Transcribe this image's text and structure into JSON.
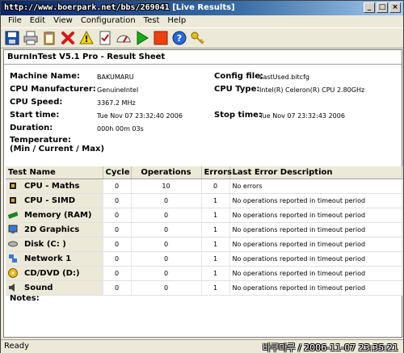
{
  "window": {
    "title_overlay": "http://www.boerpark.net/bbs/269041",
    "title_suffix": "[Live Results]",
    "btn_min": "_",
    "btn_max": "□",
    "btn_close": "×"
  },
  "menu": [
    "File",
    "Edit",
    "View",
    "Configuration",
    "Test",
    "Help"
  ],
  "toolbar": [
    "save-icon",
    "print-icon",
    "clipboard-icon",
    "stop-x-icon",
    "warning-icon",
    "checklist-icon",
    "speedometer-icon",
    "play-icon",
    "stop-icon",
    "help-icon",
    "key-icon"
  ],
  "sheet": {
    "title": "BurnInTest V5.1 Pro - Result Sheet",
    "machine_name_label": "Machine Name:",
    "machine_name": "BAKUMARU",
    "cpu_manufacturer_label": "CPU Manufacturer:",
    "cpu_manufacturer": "GenuineIntel",
    "cpu_speed_label": "CPU Speed:",
    "cpu_speed": "3367.2 MHz",
    "start_time_label": "Start time:",
    "start_time": "Tue Nov 07 23:32:40 2006",
    "duration_label": "Duration:",
    "duration": "000h 00m 03s",
    "temperature_label": "Temperature:",
    "temperature_sub": "(Min / Current / Max)",
    "config_file_label": "Config file:",
    "config_file": "LastUsed.bitcfg",
    "cpu_type_label": "CPU Type:",
    "cpu_type": "Intel(R) Celeron(R) CPU 2.80GHz",
    "stop_time_label": "Stop time:",
    "stop_time": "Tue Nov 07 23:32:43 2006",
    "notes_label": "Notes:"
  },
  "table": {
    "headers": {
      "test_name": "Test Name",
      "cycle": "Cycle",
      "operations": "Operations",
      "errors": "Errors",
      "last_error": "Last Error Description"
    },
    "rows": [
      {
        "name": "CPU - Maths",
        "cycle": "0",
        "operations": "10",
        "errors": "0",
        "desc": "No errors"
      },
      {
        "name": "CPU - SIMD",
        "cycle": "0",
        "operations": "0",
        "errors": "1",
        "desc": "No operations reported in timeout period"
      },
      {
        "name": "Memory (RAM)",
        "cycle": "0",
        "operations": "0",
        "errors": "1",
        "desc": "No operations reported in timeout period"
      },
      {
        "name": "2D Graphics",
        "cycle": "0",
        "operations": "0",
        "errors": "1",
        "desc": "No operations reported in timeout period"
      },
      {
        "name": "Disk (C: )",
        "cycle": "0",
        "operations": "0",
        "errors": "1",
        "desc": "No operations reported in timeout period"
      },
      {
        "name": "Network 1",
        "cycle": "0",
        "operations": "0",
        "errors": "1",
        "desc": "No operations reported in timeout period"
      },
      {
        "name": "CD/DVD (D:)",
        "cycle": "0",
        "operations": "0",
        "errors": "1",
        "desc": "No operations reported in timeout period"
      },
      {
        "name": "Sound",
        "cycle": "0",
        "operations": "0",
        "errors": "1",
        "desc": "No operations reported in timeout period"
      }
    ],
    "row_icons": [
      "cpu-chip-icon",
      "cpu-chip-icon",
      "memory-stick-icon",
      "monitor-icon",
      "disk-drive-icon",
      "network-icon",
      "cd-icon",
      "speaker-icon"
    ]
  },
  "status": {
    "text": "Ready",
    "watermark": "바쿠마루 / 2006-11-07 23:35:21"
  }
}
